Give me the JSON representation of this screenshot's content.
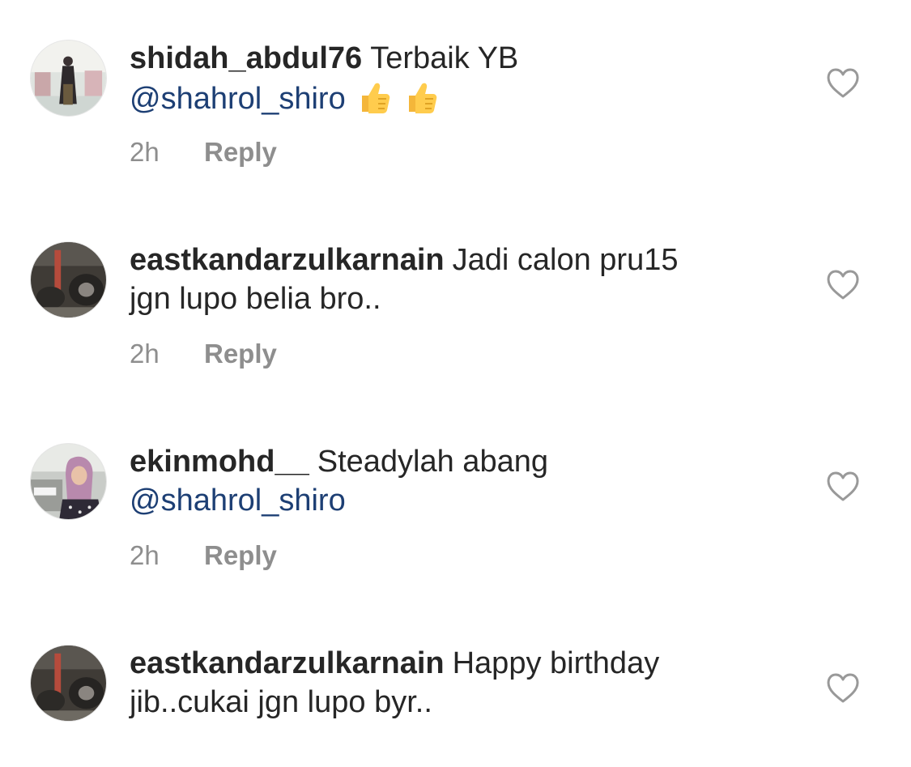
{
  "comments": [
    {
      "username": "shidah_abdul76",
      "text": "Terbaik YB",
      "mention": "@shahrol_shiro",
      "emoji": "thumbs-up-icon",
      "line2_text": "",
      "time": "2h",
      "reply_label": "Reply"
    },
    {
      "username": "eastkandarzulkarnain",
      "text": "Jadi calon pru15",
      "mention": "",
      "line2_text": "jgn lupo belia bro..",
      "time": "2h",
      "reply_label": "Reply"
    },
    {
      "username": "ekinmohd__",
      "text": "Steadylah abang",
      "mention": "@shahrol_shiro",
      "line2_text": "",
      "time": "2h",
      "reply_label": "Reply"
    },
    {
      "username": "eastkandarzulkarnain",
      "text": "Happy birthday",
      "mention": "",
      "line2_text": "jib..cukai jgn lupo byr..",
      "time": "",
      "reply_label": ""
    }
  ],
  "colors": {
    "text": "#262626",
    "mention": "#1d3f74",
    "meta": "#8e8e8e",
    "heart": "#999999"
  }
}
